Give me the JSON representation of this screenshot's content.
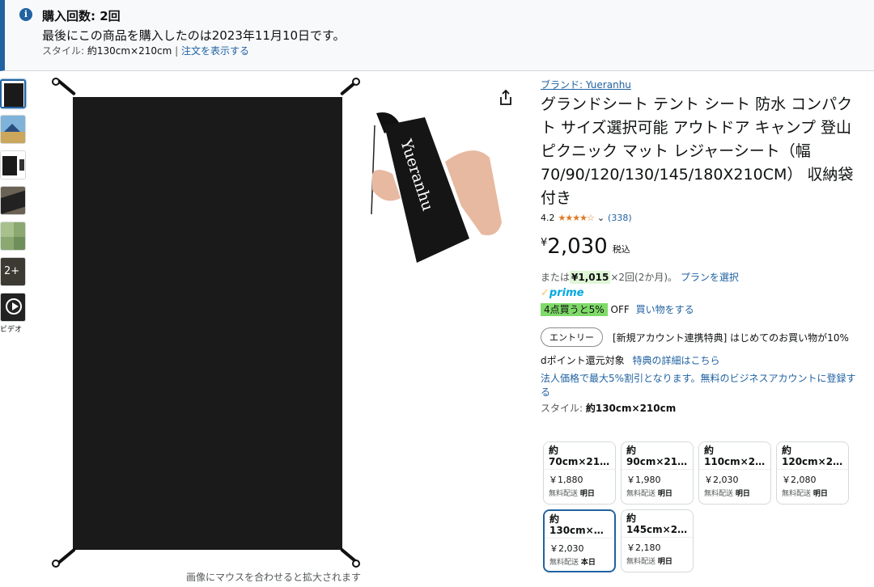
{
  "banner": {
    "title": "購入回数: 2回",
    "text": "最後にこの商品を購入したのは2023年11月10日です。",
    "style_prefix": "スタイル: ",
    "style_value": "約130cm×210cm",
    "separator": " | ",
    "order_link": "注文を表示する"
  },
  "thumbnails": {
    "more_label": "2+",
    "video_label": "ビデオ"
  },
  "image": {
    "hover_hint": "画像にマウスを合わせると拡大されます",
    "bag_brand": "Yueranhu"
  },
  "product": {
    "brand": "ブランド: Yueranhu",
    "title": "グランドシート テント シート 防水 コンパクト サイズ選択可能 アウトドア キャンプ 登山 ピクニック マット レジャーシート（幅70/90/120/130/145/180X210CM） 収納袋付き",
    "rating": "4.2",
    "stars": "★★★★☆",
    "review_count": "(338)",
    "price_currency": "¥",
    "price": "2,030",
    "tax": "税込",
    "installment_prefix": "または",
    "installment_amount": "¥1,015",
    "installment_suffix": "×2回(2か月)。",
    "installment_link": "プランを選択",
    "prime": "prime",
    "deal_badge": "4点買うと5%",
    "deal_off": "OFF",
    "deal_link": "買い物をする",
    "entry_button": "エントリー",
    "entry_text": "[新規アカウント連携特典] はじめてのお買い物が10%",
    "dpoint_text": "dポイント還元対象",
    "dpoint_link": "特典の詳細はこちら",
    "business_text": "法人価格で最大5%割引となります。無料のビジネスアカウントに登録する",
    "style_label": "スタイル: ",
    "style_value": "約130cm×210cm"
  },
  "options": [
    {
      "line1": "約",
      "line2": "70cm×21…",
      "price": "￥1,880",
      "ship": "無料配送",
      "day": "明日"
    },
    {
      "line1": "約",
      "line2": "90cm×21…",
      "price": "￥1,980",
      "ship": "無料配送",
      "day": "明日"
    },
    {
      "line1": "約",
      "line2": "110cm×2…",
      "price": "￥2,030",
      "ship": "無料配送",
      "day": "明日"
    },
    {
      "line1": "約",
      "line2": "120cm×2…",
      "price": "￥2,080",
      "ship": "無料配送",
      "day": "明日"
    },
    {
      "line1": "約",
      "line2": "130cm×2…",
      "price": "￥2,030",
      "ship": "無料配送",
      "day": "本日"
    },
    {
      "line1": "約",
      "line2": "145cm×2…",
      "price": "￥2,180",
      "ship": "無料配送",
      "day": "明日"
    }
  ],
  "colors": {
    "link": "#2162a1",
    "rating_star": "#de7921",
    "deal_badge": "#7fda69",
    "prime": "#00a8e1"
  }
}
